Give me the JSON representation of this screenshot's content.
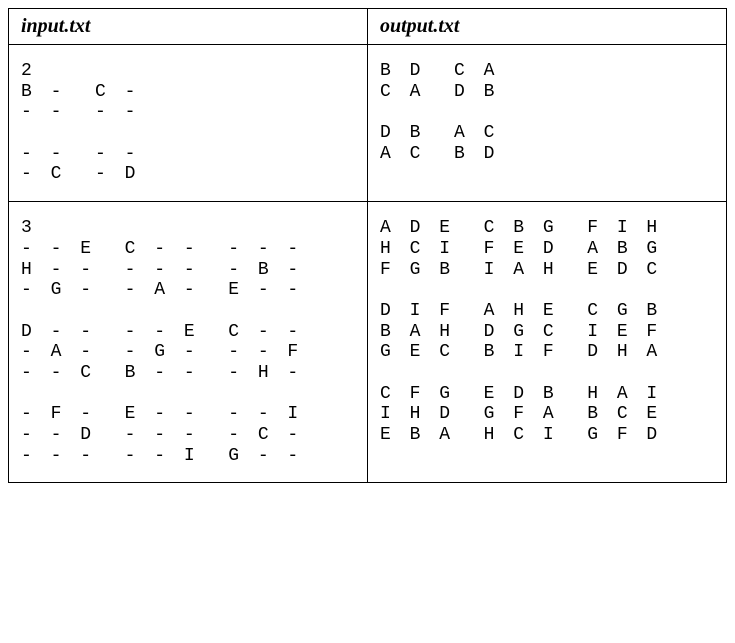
{
  "headers": {
    "input": "input.txt",
    "output": "output.txt"
  },
  "rows": [
    {
      "input": "2\nB -  C -\n- -  - -\n\n- -  - -\n- C  - D",
      "output": "B D  C A\nC A  D B\n\nD B  A C\nA C  B D"
    },
    {
      "input": "3\n- - E  C - -  - - -\nH - -  - - -  - B -\n- G -  - A -  E - -\n\nD - -  - - E  C - -\n- A -  - G -  - - F\n- - C  B - -  - H -\n\n- F -  E - -  - - I\n- - D  - - -  - C -\n- - -  - - I  G - -",
      "output": "A D E  C B G  F I H\nH C I  F E D  A B G\nF G B  I A H  E D C\n\nD I F  A H E  C G B\nB A H  D G C  I E F\nG E C  B I F  D H A\n\nC F G  E D B  H A I\nI H D  G F A  B C E\nE B A  H C I  G F D"
    }
  ]
}
